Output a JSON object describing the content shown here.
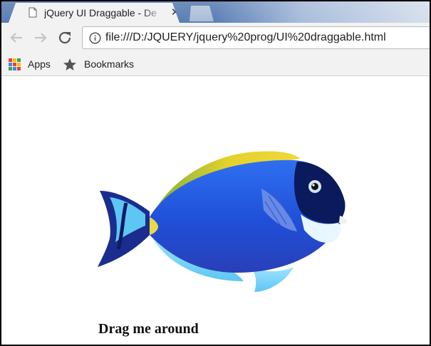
{
  "browser": {
    "tab": {
      "title": "jQuery UI Draggable - De",
      "close_glyph": "✕"
    },
    "address_bar": {
      "url": "file:///D:/JQUERY/jquery%20prog/UI%20draggable.html"
    },
    "bookmarks_bar": {
      "apps_label": "Apps",
      "bookmarks_label": "Bookmarks"
    },
    "colors": {
      "tabstrip": "#6f8ebb",
      "toolbar": "#f2f2f2"
    }
  },
  "page": {
    "draggable_image": {
      "icon": "fish-image"
    },
    "caption": "Drag me around"
  }
}
